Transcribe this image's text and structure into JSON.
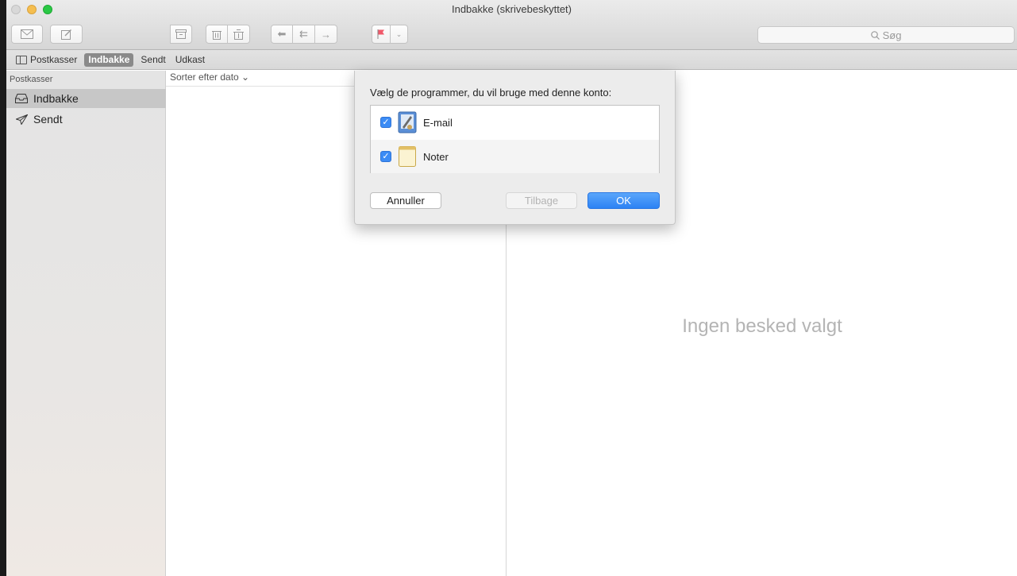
{
  "window": {
    "title": "Indbakke (skrivebeskyttet)"
  },
  "toolbar": {
    "buttons": [
      "envelope-icon",
      "compose-icon",
      "archive-icon",
      "trash-icon",
      "junk-icon",
      "reply-icon",
      "reply-all-icon",
      "forward-icon",
      "flag-icon",
      "chevron-down-icon"
    ],
    "search_placeholder": "Søg"
  },
  "favorites": {
    "mailboxes_label": "Postkasser",
    "inbox_label": "Indbakke",
    "sent_label": "Sendt",
    "drafts_label": "Udkast"
  },
  "sidebar": {
    "header": "Postkasser",
    "items": [
      {
        "label": "Indbakke",
        "icon": "inbox-icon",
        "selected": true
      },
      {
        "label": "Sendt",
        "icon": "paper-plane-icon",
        "selected": false
      }
    ]
  },
  "message_list": {
    "sort_label": "Sorter efter dato ⌄"
  },
  "viewer": {
    "empty_text": "Ingen besked valgt"
  },
  "dialog": {
    "prompt": "Vælg de programmer, du vil bruge med denne konto:",
    "apps": [
      {
        "label": "E-mail",
        "checked": true,
        "icon": "mail-app-icon"
      },
      {
        "label": "Noter",
        "checked": true,
        "icon": "notes-app-icon"
      }
    ],
    "cancel_label": "Annuller",
    "back_label": "Tilbage",
    "ok_label": "OK"
  },
  "colors": {
    "accent": "#2c82f4",
    "checkbox": "#3c8cf5"
  }
}
